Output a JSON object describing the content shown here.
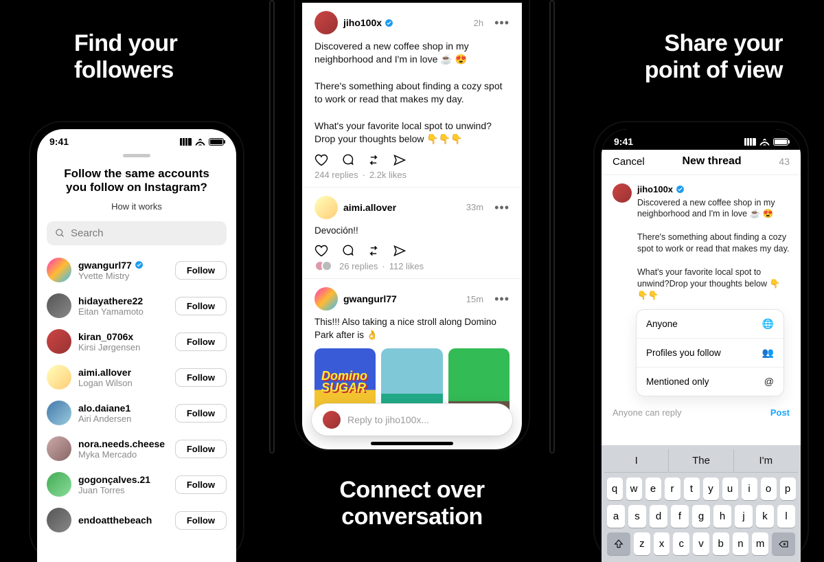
{
  "taglines": {
    "left_l1": "Find your",
    "left_l2": "followers",
    "center_l1": "Connect over",
    "center_l2": "conversation",
    "right_l1": "Share your",
    "right_l2": "point of view"
  },
  "status_time": "9:41",
  "left": {
    "title": "Follow the same accounts you follow on Instagram?",
    "subtitle": "How it works",
    "search_placeholder": "Search",
    "follow_label": "Follow",
    "users": [
      {
        "u": "gwangurl77",
        "n": "Yvette Mistry",
        "verified": true,
        "avClass": "a1"
      },
      {
        "u": "hidayathere22",
        "n": "Eitan Yamamoto",
        "verified": false,
        "avClass": "a2"
      },
      {
        "u": "kiran_0706x",
        "n": "Kirsi Jørgensen",
        "verified": false,
        "avClass": "a3"
      },
      {
        "u": "aimi.allover",
        "n": "Logan Wilson",
        "verified": false,
        "avClass": "a4"
      },
      {
        "u": "alo.daiane1",
        "n": "Airi Andersen",
        "verified": false,
        "avClass": "a5"
      },
      {
        "u": "nora.needs.cheese",
        "n": "Myka Mercado",
        "verified": false,
        "avClass": "a6"
      },
      {
        "u": "gogonçalves.21",
        "n": "Juan Torres",
        "verified": false,
        "avClass": "a7"
      },
      {
        "u": "endoatthebeach",
        "n": "",
        "verified": false,
        "avClass": "a2"
      }
    ]
  },
  "mid": {
    "post1": {
      "user": "jiho100x",
      "verified": true,
      "time": "2h",
      "body": "Discovered a new coffee shop in my neighborhood and I'm in love ☕ 😍\n\nThere's something about finding a cozy spot to work or read that makes my day.\n\nWhat's your favorite local spot to unwind? Drop your thoughts below 👇👇👇",
      "replies": "244 replies",
      "likes": "2.2k likes"
    },
    "post2": {
      "user": "aimi.allover",
      "time": "33m",
      "body": "Devoción!!",
      "replies": "26 replies",
      "likes": "112 likes"
    },
    "post3": {
      "user": "gwangurl77",
      "time": "15m",
      "body": "This!!! Also taking a nice stroll along Domino Park after is 👌"
    },
    "reply_placeholder": "Reply to jiho100x..."
  },
  "right": {
    "cancel": "Cancel",
    "title": "New thread",
    "count": "43",
    "user": "jiho100x",
    "verified": true,
    "body": "Discovered a new coffee shop in my neighborhood and I'm in love ☕ 😍\n\nThere's something about finding a cozy spot to work or read that makes my day.\n\nWhat's your favorite local spot to unwind?Drop your thoughts below 👇👇👇",
    "menu": [
      {
        "label": "Anyone",
        "glyph": "🌐"
      },
      {
        "label": "Profiles you follow",
        "glyph": "👥"
      },
      {
        "label": "Mentioned only",
        "glyph": "@"
      }
    ],
    "reply_hint": "Anyone can reply",
    "post_label": "Post",
    "suggestions": [
      "I",
      "The",
      "I'm"
    ],
    "rows": [
      [
        "q",
        "w",
        "e",
        "r",
        "t",
        "y",
        "u",
        "i",
        "o",
        "p"
      ],
      [
        "a",
        "s",
        "d",
        "f",
        "g",
        "h",
        "j",
        "k",
        "l"
      ],
      [
        "z",
        "x",
        "c",
        "v",
        "b",
        "n",
        "m"
      ]
    ]
  }
}
